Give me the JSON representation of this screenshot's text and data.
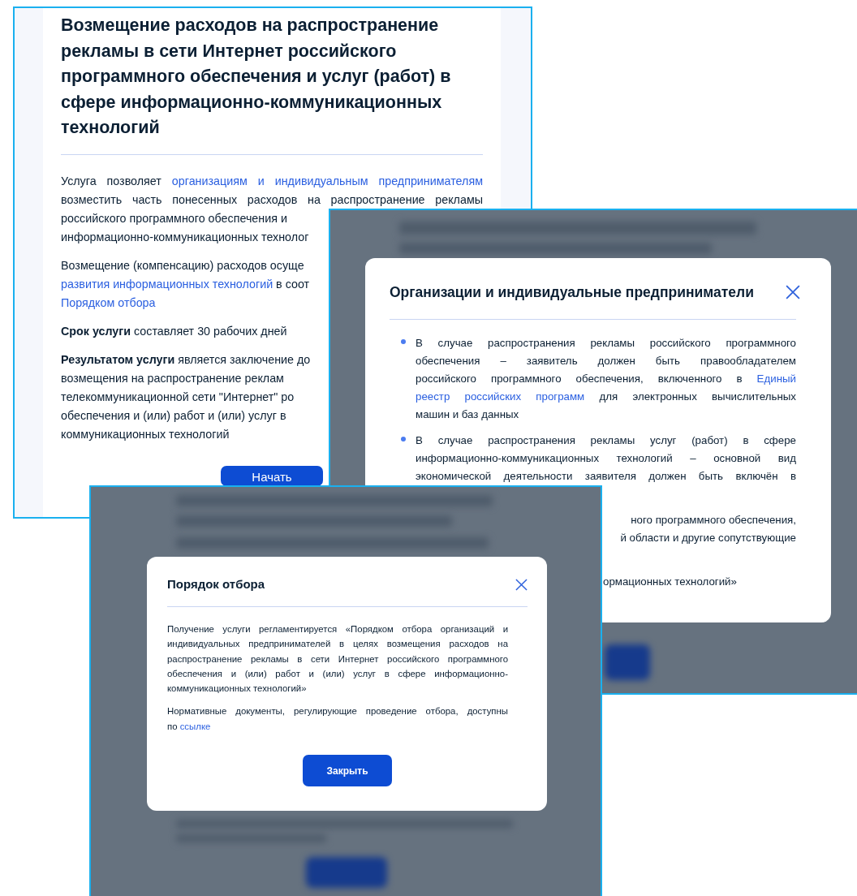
{
  "screens": [
    {
      "kind": "page",
      "title_lines": [
        "Возмещение расходов на распространение",
        "рекламы в сети Интернет российского",
        "программного обеспечения и услуг (работ) в",
        "сфере информационно-коммуникационных",
        "технологий"
      ],
      "blocks": [
        {
          "kind": "paragraph",
          "lines": [
            {
              "kind": "full",
              "parts": [
                {
                  "kind": "plain",
                  "text": "Услуга позволяет "
                },
                {
                  "kind": "link",
                  "text": "организациям и индивидуальным предпринимателям"
                }
              ]
            },
            {
              "kind": "full",
              "parts": [
                {
                  "kind": "plain",
                  "text": "возместить часть понесенных расходов на распространение рекламы"
                }
              ]
            },
            {
              "kind": "cut",
              "parts": [
                {
                  "kind": "plain",
                  "text": "российского программного обеспечения и"
                }
              ]
            },
            {
              "kind": "cut",
              "parts": [
                {
                  "kind": "plain",
                  "text": "информационно-коммуникационных технолог"
                }
              ]
            }
          ]
        },
        {
          "kind": "paragraph",
          "lines": [
            {
              "kind": "cut",
              "parts": [
                {
                  "kind": "plain",
                  "text": "Возмещение (компенсацию) расходов осуще"
                }
              ]
            },
            {
              "kind": "cut",
              "parts": [
                {
                  "kind": "link",
                  "text": "развития информационных технологий"
                },
                {
                  "kind": "plain",
                  "text": " в соот"
                }
              ]
            },
            {
              "kind": "end",
              "parts": [
                {
                  "kind": "link",
                  "text": "Порядком отбора"
                }
              ]
            }
          ]
        },
        {
          "kind": "paragraph",
          "lines": [
            {
              "kind": "end",
              "parts": [
                {
                  "kind": "bold",
                  "text": "Срок услуги"
                },
                {
                  "kind": "plain",
                  "text": " составляет 30 рабочих дней"
                }
              ]
            }
          ]
        },
        {
          "kind": "paragraph",
          "lines": [
            {
              "kind": "cut",
              "parts": [
                {
                  "kind": "bold",
                  "text": "Результатом услуги"
                },
                {
                  "kind": "plain",
                  "text": " является заключение до"
                }
              ]
            },
            {
              "kind": "cut",
              "parts": [
                {
                  "kind": "plain",
                  "text": "возмещения на распространение реклам"
                }
              ]
            },
            {
              "kind": "cut",
              "parts": [
                {
                  "kind": "plain",
                  "text": "телекоммуникационной сети \"Интернет\" ро"
                }
              ]
            },
            {
              "kind": "cut",
              "parts": [
                {
                  "kind": "plain",
                  "text": "обеспечения и (или) работ и (или) услуг в"
                }
              ]
            },
            {
              "kind": "end",
              "parts": [
                {
                  "kind": "plain",
                  "text": "коммуникационных технологий"
                }
              ]
            }
          ]
        }
      ],
      "button": "Начать"
    },
    {
      "kind": "modal",
      "title": "Организации и индивидуальные предприниматели",
      "blocks": [
        {
          "kind": "bullet",
          "lines": [
            {
              "kind": "full",
              "parts": [
                {
                  "kind": "plain",
                  "text": "В случае распространения рекламы российского программного"
                }
              ]
            },
            {
              "kind": "full",
              "parts": [
                {
                  "kind": "plain",
                  "text": "обеспечения – заявитель должен быть правообладателем"
                }
              ]
            },
            {
              "kind": "full",
              "parts": [
                {
                  "kind": "plain",
                  "text": "российского программного обеспечения, включенного в "
                },
                {
                  "kind": "link",
                  "text": "Единый"
                }
              ]
            },
            {
              "kind": "full",
              "parts": [
                {
                  "kind": "link",
                  "text": "реестр российских программ"
                },
                {
                  "kind": "plain",
                  "text": " для электронных вычислительных"
                }
              ]
            },
            {
              "kind": "end",
              "parts": [
                {
                  "kind": "plain",
                  "text": "машин и баз данных"
                }
              ]
            }
          ]
        },
        {
          "kind": "bullet",
          "lines": [
            {
              "kind": "full",
              "parts": [
                {
                  "kind": "plain",
                  "text": "В случае распространения рекламы услуг (работ) в сфере"
                }
              ]
            },
            {
              "kind": "full",
              "parts": [
                {
                  "kind": "plain",
                  "text": "информационно-коммуникационных технологий – основной вид"
                }
              ]
            },
            {
              "kind": "full",
              "parts": [
                {
                  "kind": "plain",
                  "text": "экономической деятельности заявителя должен быть включён в"
                }
              ]
            }
          ]
        },
        {
          "kind": "fragment",
          "lines": [
            {
              "kind": "right",
              "parts": [
                {
                  "kind": "plain",
                  "text": "ного программного обеспечения,"
                }
              ]
            },
            {
              "kind": "right",
              "parts": [
                {
                  "kind": "plain",
                  "text": "й области и другие сопутствующие"
                }
              ]
            }
          ]
        },
        {
          "kind": "fragment",
          "lines": [
            {
              "kind": "tail",
              "parts": [
                {
                  "kind": "plain",
                  "text": "ормационных технологий»"
                }
              ]
            }
          ]
        }
      ]
    },
    {
      "kind": "small_modal",
      "title": "Порядок отбора",
      "blocks": [
        {
          "kind": "paragraph",
          "lines": [
            {
              "kind": "full",
              "parts": [
                {
                  "kind": "plain",
                  "text": "Получение услуги регламентируется «Порядком отбора организаций и"
                }
              ]
            },
            {
              "kind": "full",
              "parts": [
                {
                  "kind": "plain",
                  "text": "индивидуальных предпринимателей в целях возмещения расходов на"
                }
              ]
            },
            {
              "kind": "full",
              "parts": [
                {
                  "kind": "plain",
                  "text": "распространение рекламы в сети Интернет российского программного"
                }
              ]
            },
            {
              "kind": "full",
              "parts": [
                {
                  "kind": "plain",
                  "text": "обеспечения и (или) работ и (или) услуг в сфере информационно-"
                }
              ]
            },
            {
              "kind": "end",
              "parts": [
                {
                  "kind": "plain",
                  "text": "коммуникационных технологий»"
                }
              ]
            }
          ]
        },
        {
          "kind": "paragraph",
          "lines": [
            {
              "kind": "full",
              "parts": [
                {
                  "kind": "plain",
                  "text": "Нормативные документы, регулирующие проведение отбора, доступны"
                }
              ]
            },
            {
              "kind": "end",
              "parts": [
                {
                  "kind": "plain",
                  "text": "по "
                },
                {
                  "kind": "link",
                  "text": "ссылке"
                }
              ]
            }
          ]
        }
      ],
      "button": "Закрыть"
    }
  ]
}
